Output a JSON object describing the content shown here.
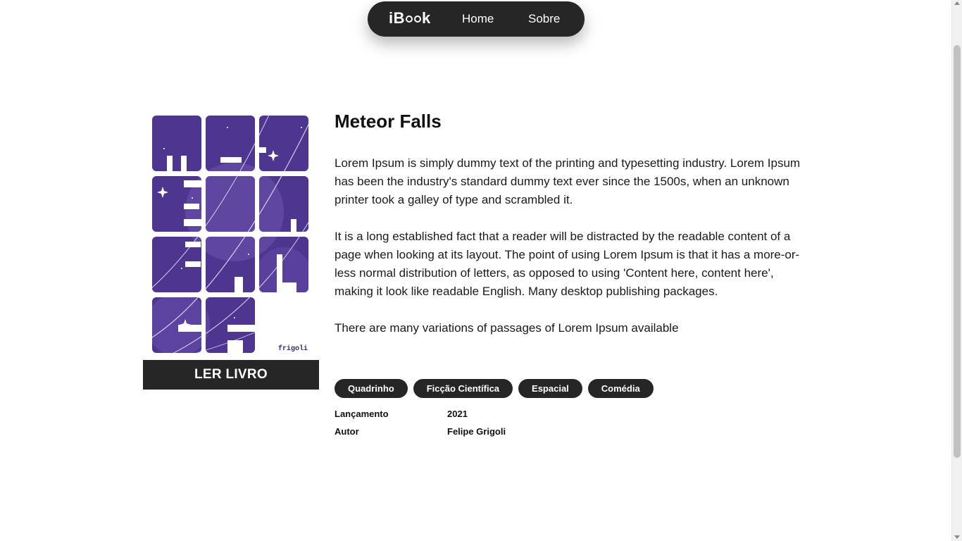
{
  "nav": {
    "logo": "iBook",
    "links": [
      "Home",
      "Sobre"
    ]
  },
  "book": {
    "title": "Meteor Falls",
    "cover_signature": "frigoli",
    "read_button": "LER LIVRO",
    "description": [
      "Lorem Ipsum is simply dummy text of the printing and typesetting industry. Lorem Ipsum has been the industry's standard dummy text ever since the 1500s, when an unknown printer took a galley of type and scrambled it.",
      "It is a long established fact that a reader will be distracted by the readable content of a page when looking at its layout. The point of using Lorem Ipsum is that it has a more-or-less normal distribution of letters, as opposed to using 'Content here, content here', making it look like readable English. Many desktop publishing packages.",
      "There are many variations of passages of Lorem Ipsum available"
    ],
    "tags": [
      "Quadrinho",
      "Ficção Científica",
      "Espacial",
      "Comédia"
    ],
    "details": [
      {
        "label": "Lançamento",
        "value": "2021"
      },
      {
        "label": "Autor",
        "value": "Felipe Grigoli"
      }
    ]
  },
  "colors": {
    "dark": "#262626",
    "cover_purple": "#4e3590",
    "cover_light": "#6a52ae"
  }
}
